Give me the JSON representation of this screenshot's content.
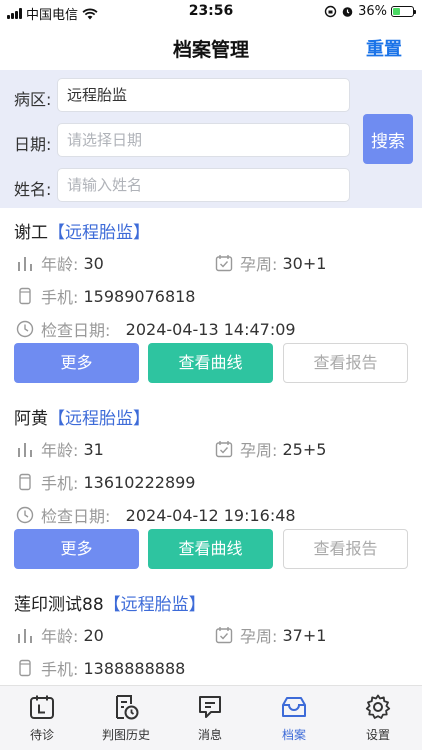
{
  "status": {
    "carrier": "中国电信",
    "time": "23:56",
    "battery": "36%",
    "battery_level": 0.36
  },
  "nav": {
    "title": "档案管理",
    "reset": "重置"
  },
  "filter": {
    "ward_label": "病区:",
    "ward_value": "远程胎监",
    "date_label": "日期:",
    "date_placeholder": "请选择日期",
    "name_label": "姓名:",
    "name_placeholder": "请输入姓名",
    "search": "搜索"
  },
  "labels": {
    "age": "年龄:",
    "week": "孕周:",
    "phone": "手机:",
    "check_date": "检查日期:"
  },
  "buttons": {
    "more": "更多",
    "curve": "查看曲线",
    "report": "查看报告"
  },
  "records": [
    {
      "name": "谢工",
      "tag": "【远程胎监】",
      "age": "30",
      "week": "30+1",
      "phone": "15989076818",
      "check_date": "2024-04-13 14:47:09"
    },
    {
      "name": "阿黄",
      "tag": "【远程胎监】",
      "age": "31",
      "week": "25+5",
      "phone": "13610222899",
      "check_date": "2024-04-12 19:16:48"
    },
    {
      "name": "莲印测试88",
      "tag": "【远程胎监】",
      "age": "20",
      "week": "37+1",
      "phone": "1388888888",
      "check_date": ""
    }
  ],
  "tabs": [
    {
      "label": "待诊",
      "icon": "calendar-icon"
    },
    {
      "label": "判图历史",
      "icon": "history-icon"
    },
    {
      "label": "消息",
      "icon": "message-icon"
    },
    {
      "label": "档案",
      "icon": "archive-icon"
    },
    {
      "label": "设置",
      "icon": "gear-icon"
    }
  ],
  "colors": {
    "accent": "#3d6bd8",
    "primary_button": "#6f8cf1",
    "curve_button": "#2ec4a0",
    "filter_bg": "#e9ecf8"
  }
}
